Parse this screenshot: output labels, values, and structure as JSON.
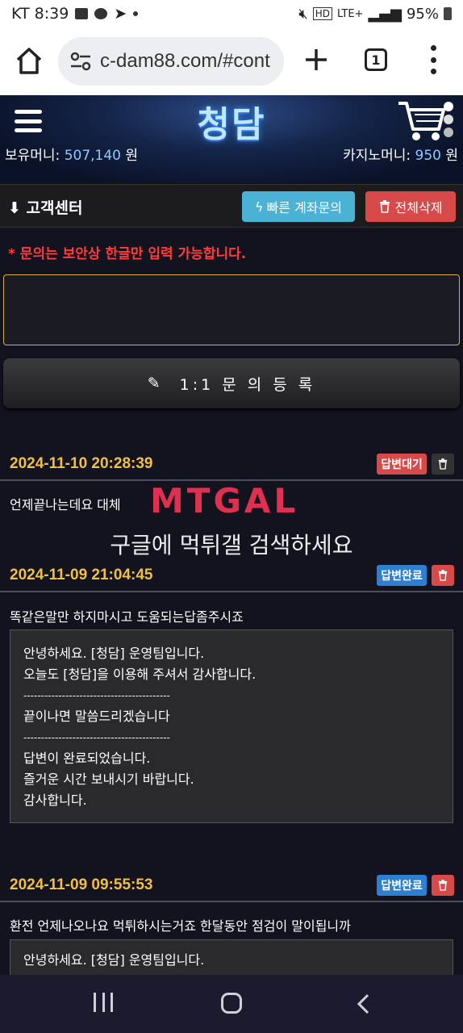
{
  "status_bar": {
    "carrier_time": "KT 8:39",
    "network": "LTE+",
    "battery": "95%",
    "hd_label": "HD"
  },
  "browser": {
    "url": "c-dam88.com/#cont",
    "tab_count": "1"
  },
  "header": {
    "logo": "청담",
    "money_label": "보유머니:",
    "money_value": "507,140",
    "money_unit": "원",
    "casino_label": "카지노머니:",
    "casino_value": "950",
    "casino_unit": "원"
  },
  "customer_center": {
    "title": "고객센터",
    "quick_button": "빠른 계좌문의",
    "delete_all_button": "전체삭제",
    "notice": "* 문의는 보안상 한글만 입력 가능합니다.",
    "register_button": "1:1 문 의 등 록"
  },
  "watermark": {
    "logo": "MTGAL",
    "text": "구글에 먹튀갤 검색하세요"
  },
  "posts": [
    {
      "date": "2024-11-10 20:28:39",
      "status": "답변대기",
      "question": "언제끝나는데요 대체"
    },
    {
      "date": "2024-11-09 21:04:45",
      "status": "답변완료",
      "question": "똑같은말만 하지마시고 도움되는답좀주시죠",
      "answer_lines": [
        "안녕하세요. [청담] 운영팀입니다.",
        "오늘도 [청담]을 이용해 주셔서 감사합니다.",
        "------------------------------------------",
        "끝이나면 말씀드리겠습니다",
        "------------------------------------------",
        "답변이 완료되었습니다.",
        "즐거운 시간 보내시기 바랍니다.",
        "감사합니다."
      ]
    },
    {
      "date": "2024-11-09 09:55:53",
      "status": "답변완료",
      "question": "환전 언제나오나요 먹튀하시는거죠 한달동안 점검이 말이됩니까",
      "answer_lines": [
        "안녕하세요. [청담] 운영팀입니다."
      ]
    }
  ],
  "colors": {
    "accent_gold": "#f0c040",
    "notice_red": "#ff3b3b",
    "badge_red": "#d84a4a",
    "badge_blue": "#2f7fd0",
    "quick_blue": "#4bb2d6"
  }
}
